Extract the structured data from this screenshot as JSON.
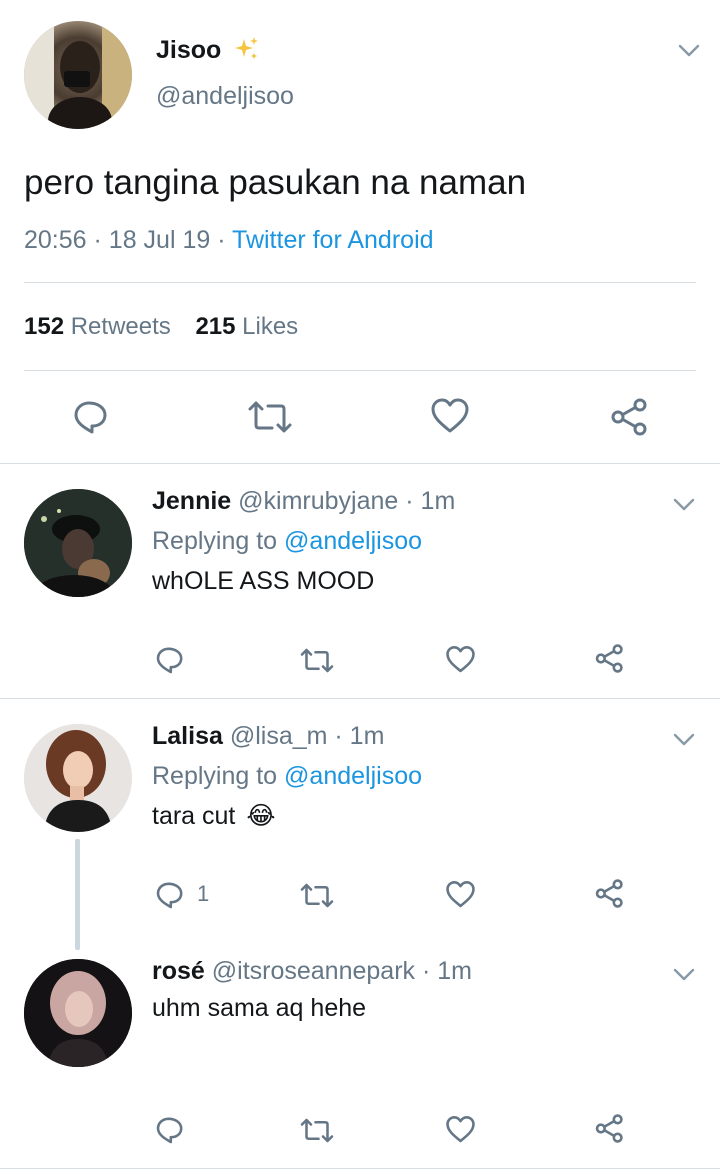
{
  "main_tweet": {
    "name": "Jisoo",
    "handle": "@andeljisoo",
    "text": "pero tangina pasukan na naman",
    "time": "20:56",
    "sep1": "·",
    "date": "18 Jul 19",
    "sep2": "·",
    "source": "Twitter for Android",
    "retweets_count": "152",
    "retweets_label": "Retweets",
    "likes_count": "215",
    "likes_label": "Likes"
  },
  "replies": [
    {
      "name": "Jennie",
      "handle": "@kimrubyjane",
      "time": "· 1m",
      "replying_label": "Replying to",
      "replying_handle": "@andeljisoo",
      "text": "whOLE ASS MOOD",
      "reply_count": ""
    },
    {
      "name": "Lalisa",
      "handle": "@lisa_m",
      "time": "· 1m",
      "replying_label": "Replying to",
      "replying_handle": "@andeljisoo",
      "text": "tara cut",
      "emoji": "😂",
      "reply_count": "1"
    },
    {
      "name": "rosé",
      "handle": "@itsroseannepark",
      "time": "· 1m",
      "text": "uhm sama aq hehe",
      "reply_count": ""
    }
  ],
  "colors": {
    "accent": "#1b95e0",
    "secondary_text": "#657786",
    "divider": "#d8dde1",
    "sparkle": "#f5c542"
  },
  "icons": [
    "chevron-down-icon",
    "sparkles-icon",
    "reply-icon",
    "retweet-icon",
    "like-icon",
    "share-icon"
  ]
}
